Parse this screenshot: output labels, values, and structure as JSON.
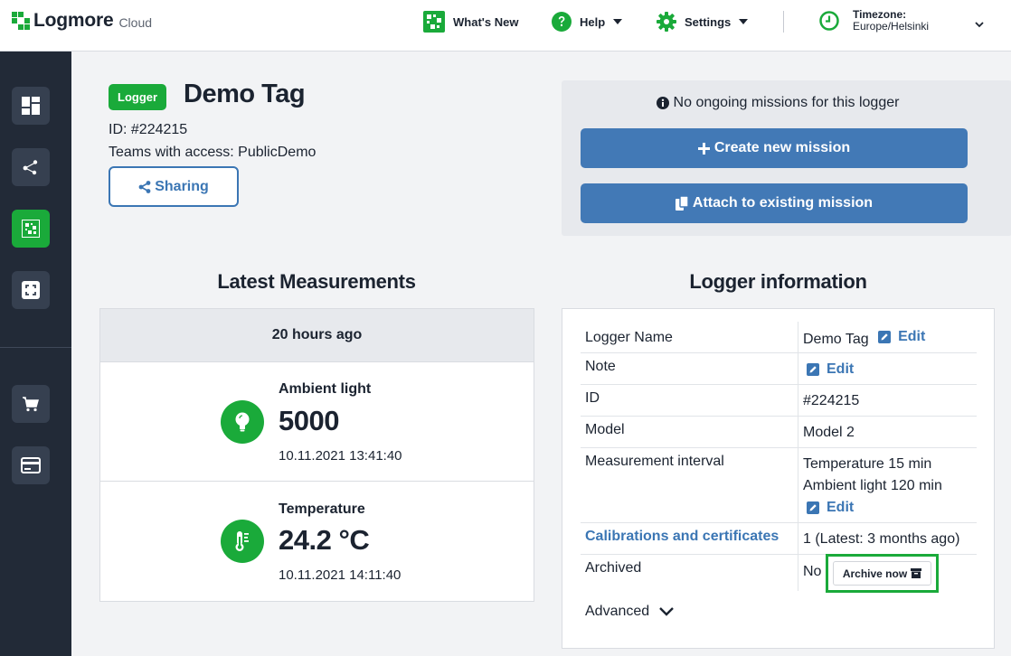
{
  "header": {
    "brand": "Logmore",
    "brand_sub": "Cloud",
    "nav": {
      "whats_new": "What's New",
      "help": "Help",
      "settings": "Settings"
    },
    "timezone": {
      "title": "Timezone:",
      "value": "Europe/Helsinki"
    }
  },
  "sidebar": {
    "items": [
      {
        "icon": "dashboard-icon"
      },
      {
        "icon": "share-nodes-icon"
      },
      {
        "icon": "qr-tag-icon",
        "active": true
      },
      {
        "icon": "scan-frame-icon"
      },
      {
        "icon": "cart-icon"
      },
      {
        "icon": "credit-card-icon"
      }
    ]
  },
  "logger": {
    "badge": "Logger",
    "title": "Demo Tag",
    "id_line": "ID: #224215",
    "teams_line": "Teams with access: PublicDemo",
    "sharing_label": "Sharing"
  },
  "missions": {
    "note": "No ongoing missions for this logger",
    "create_label": "Create new mission",
    "attach_label": "Attach to existing mission"
  },
  "latest": {
    "title": "Latest Measurements",
    "when": "20 hours ago",
    "items": [
      {
        "name": "Ambient light",
        "value": "5000",
        "time": "10.11.2021 13:41:40",
        "icon": "bulb-icon"
      },
      {
        "name": "Temperature",
        "value": "24.2 °C",
        "time": "10.11.2021 14:11:40",
        "icon": "thermometer-icon"
      }
    ]
  },
  "info": {
    "title": "Logger information",
    "edit_label": "Edit",
    "rows": {
      "name_key": "Logger Name",
      "name_val": "Demo Tag",
      "note_key": "Note",
      "id_key": "ID",
      "id_val": "#224215",
      "model_key": "Model",
      "model_val": "Model 2",
      "interval_key": "Measurement interval",
      "interval_val_1": "Temperature 15 min",
      "interval_val_2": "Ambient light 120 min",
      "calib_key": "Calibrations and certificates",
      "calib_val": "1 (Latest: 3 months ago)",
      "archived_key": "Archived",
      "archived_val": "No",
      "archive_button": "Archive now"
    },
    "advanced_label": "Advanced"
  },
  "colors": {
    "brand_green": "#1aaa3a",
    "primary_blue": "#4279b6",
    "sidebar_bg": "#222a37"
  }
}
